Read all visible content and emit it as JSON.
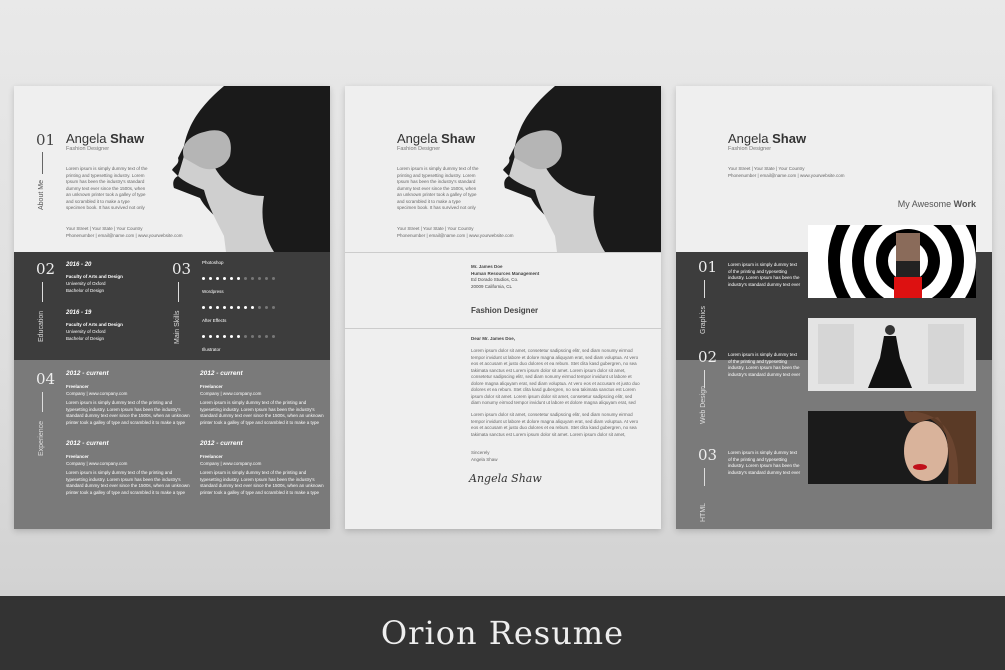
{
  "footer_title": "Orion Resume",
  "person": {
    "first": "Angela",
    "last": "Shaw",
    "title": "Fashion Designer",
    "address": "Your Street | Your State | Your Country",
    "contact": "Phonenumber | email@name.com | www.yourwebsite.com",
    "intro": "Lorem ipsum is simply dummy text of the printing and typesetting industry. Lorem Ipsum has been the industry's standard dummy text ever since the 1500s, when an unknown printer took a galley of type and scrambled it to make a type specimen book. It has survived not only five centuries, but also the leap into electronic typesetting, remaining essentially unchanged."
  },
  "page1": {
    "about": {
      "num": "01",
      "label": "About Me"
    },
    "education": {
      "num": "02",
      "label": "Education",
      "entries": [
        {
          "years_a": "2016 - ",
          "years_b": "20",
          "faculty": "Faculty of Arts and Design",
          "uni": "University of Oxford",
          "degree": "Bachelor of Design"
        },
        {
          "years_a": "2016 - ",
          "years_b": "19",
          "faculty": "Faculty of Arts and Design",
          "uni": "University of Oxford",
          "degree": "Bachelor of Design"
        }
      ]
    },
    "skills": {
      "num": "03",
      "label": "Main Skills",
      "items": [
        {
          "name": "Photoshop",
          "level": 0.55
        },
        {
          "name": "Wordpress",
          "level": 0.7
        },
        {
          "name": "After Effects",
          "level": 0.5
        },
        {
          "name": "Illustrator",
          "level": 0.6
        },
        {
          "name": "HTML 5",
          "level": 0.65
        },
        {
          "name": "Coding",
          "level": 0.45
        }
      ]
    },
    "experience": {
      "num": "04",
      "label": "Experience",
      "cols": [
        [
          {
            "year": "2012 - ",
            "cur": "current",
            "role": "Freelancer",
            "company": "Company | www.company.com",
            "desc": "Lorem ipsum is simply dummy text of the printing and typesetting industry. Lorem Ipsum has been the industry's standard dummy text ever since the 1500s, when an unknown printer took a galley of type and scrambled it to make a type specimen book."
          },
          {
            "year": "2012 - ",
            "cur": "current",
            "role": "Freelancer",
            "company": "Company | www.company.com",
            "desc": "Lorem ipsum is simply dummy text of the printing and typesetting industry. Lorem Ipsum has been the industry's standard dummy text ever since the 1500s, when an unknown printer took a galley of type and scrambled it to make a type specimen book."
          }
        ],
        [
          {
            "year": "2012 - ",
            "cur": "current",
            "role": "Freelancer",
            "company": "Company | www.company.com",
            "desc": "Lorem ipsum is simply dummy text of the printing and typesetting industry. Lorem Ipsum has been the industry's standard dummy text ever since the 1500s, when an unknown printer took a galley of type and scrambled it to make a type specimen book."
          },
          {
            "year": "2012 - ",
            "cur": "current",
            "role": "Freelancer",
            "company": "Company | www.company.com",
            "desc": "Lorem ipsum is simply dummy text of the printing and typesetting industry. Lorem Ipsum has been the industry's standard dummy text ever since the 1500s, when an unknown printer took a galley of type and scrambled it to make a type specimen book."
          }
        ]
      ]
    }
  },
  "page2": {
    "recipient": [
      "Mr. James Doe",
      "Human Resources Management",
      "Ed Dorado Studios, Co.",
      "20009 California, CL"
    ],
    "heading": "Fashion Designer",
    "greeting": "Dear Mr. James Doe,",
    "body1": "Lorem ipsum dolor sit amet, consetetur sadipscing elitr, sed diam nonumy eirmod tempor invidunt ut labore et dolore magna aliquyam erat, sed diam voluptua. At vero eos et accusam et justo duo dolores et ea rebum. Stet clita kasd gubergren, no sea takimata sanctus est Lorem ipsum dolor sit amet. Lorem ipsum dolor sit amet, consetetur sadipscing elitr, sed diam nonumy eirmod tempor invidunt ut labore et dolore magna aliquyam erat, sed diam voluptua. At vero eos et accusam et justo duo dolores et ea rebum. Stet clita kasd gubergren, no sea takimata sanctus est Lorem ipsum dolor sit amet. Lorem ipsum dolor sit amet, consetetur sadipscing elitr, sed diam nonumy eirmod tempor invidunt ut labore et dolore magna aliquyam erat, sed diam voluptua. At vero eos et accusam et justo duo dolores et ea rebum. Stet clita kasd gubergren, no sea takimata sanctus est Lorem ipsum dolor sit amet.",
    "body2": "Lorem ipsum dolor sit amet, consetetur sadipscing elitr, sed diam nonumy eirmod tempor invidunt ut labore et dolore magna aliquyam erat, sed diam voluptua. At vero eos et accusam et justo duo dolores et ea rebum. Stet clita kasd gubergren, no sea takimata sanctus est Lorem ipsum dolor sit amet. Lorem ipsum dolor sit amet, consetetur sadipscing elitr, sed diam nonumy.",
    "closing": "Sincerely",
    "closing_name": "Angela Shaw",
    "signature": "Angela Shaw"
  },
  "page3": {
    "work_title_a": "My Awesome ",
    "work_title_b": "Work",
    "works": [
      {
        "num": "01",
        "label": "Graphics",
        "desc": "Lorem ipsum is simply dummy text of the printing and typesetting industry. Lorem Ipsum has been the industry's standard dummy text ever since."
      },
      {
        "num": "02",
        "label": "Web Design",
        "desc": "Lorem ipsum is simply dummy text of the printing and typesetting industry. Lorem Ipsum has been the industry's standard dummy text ever since."
      },
      {
        "num": "03",
        "label": "HTML",
        "desc": "Lorem ipsum is simply dummy text of the printing and typesetting industry. Lorem Ipsum has been the industry's standard dummy text ever since."
      }
    ]
  }
}
